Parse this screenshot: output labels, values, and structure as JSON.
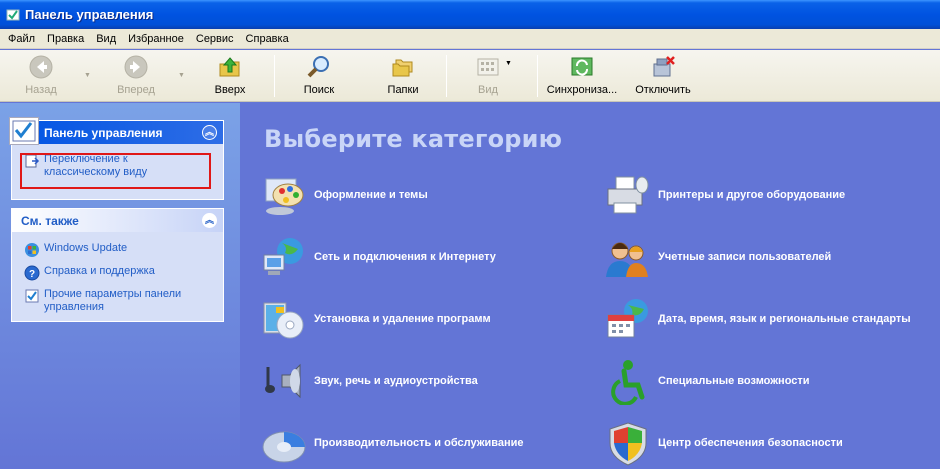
{
  "window": {
    "title": "Панель управления"
  },
  "menu": [
    "Файл",
    "Правка",
    "Вид",
    "Избранное",
    "Сервис",
    "Справка"
  ],
  "toolbar": {
    "back": "Назад",
    "forward": "Вперед",
    "up": "Вверх",
    "search": "Поиск",
    "folders": "Папки",
    "view": "Вид",
    "sync": "Синхрониза...",
    "disconnect": "Отключить"
  },
  "left": {
    "control_panel": {
      "title": "Панель управления",
      "switch_link": "Переключение к классическому виду"
    },
    "see_also": {
      "title": "См. также",
      "links": [
        "Windows Update",
        "Справка и поддержка",
        "Прочие параметры панели управления"
      ]
    }
  },
  "main": {
    "heading": "Выберите категорию",
    "categories": [
      "Оформление и темы",
      "Принтеры и другое оборудование",
      "Сеть и подключения к Интернету",
      "Учетные записи пользователей",
      "Установка и удаление программ",
      "Дата, время, язык и региональные стандарты",
      "Звук, речь и аудиоустройства",
      "Специальные возможности",
      "Производительность и обслуживание",
      "Центр обеспечения безопасности"
    ]
  }
}
